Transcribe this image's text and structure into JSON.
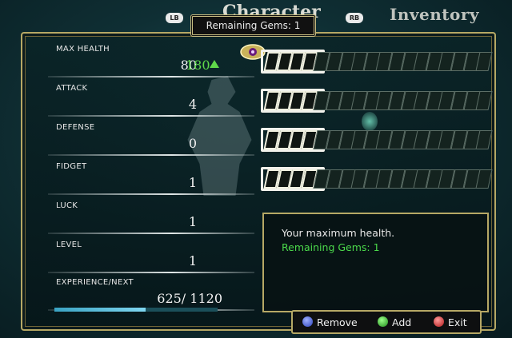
{
  "header": {
    "tab_character": "Character",
    "tab_inventory": "Inventory",
    "lb_label": "LB",
    "rb_label": "RB",
    "remaining_gems": "Remaining Gems: 1"
  },
  "stats": [
    {
      "label": "MAX HEALTH",
      "value": "80",
      "next": "180"
    },
    {
      "label": "ATTACK",
      "value": "4"
    },
    {
      "label": "DEFENSE",
      "value": "0"
    },
    {
      "label": "FIDGET",
      "value": "1"
    },
    {
      "label": "LUCK",
      "value": "1"
    },
    {
      "label": "LEVEL",
      "value": "1"
    },
    {
      "label": "EXPERIENCE/NEXT",
      "value": "625/ 1120"
    }
  ],
  "experience": {
    "current": 625,
    "next": 1120
  },
  "gauges": [
    {
      "filled": 4,
      "total": 18
    },
    {
      "filled": 4,
      "total": 18
    },
    {
      "filled": 4,
      "total": 18
    },
    {
      "filled": 4,
      "total": 18
    }
  ],
  "description": {
    "text": "Your maximum health.",
    "sub": "Remaining Gems: 1"
  },
  "controls": {
    "remove": "Remove",
    "add": "Add",
    "exit": "Exit"
  },
  "colors": {
    "accent_gold": "#b6a865",
    "positive_green": "#5fd84a"
  }
}
